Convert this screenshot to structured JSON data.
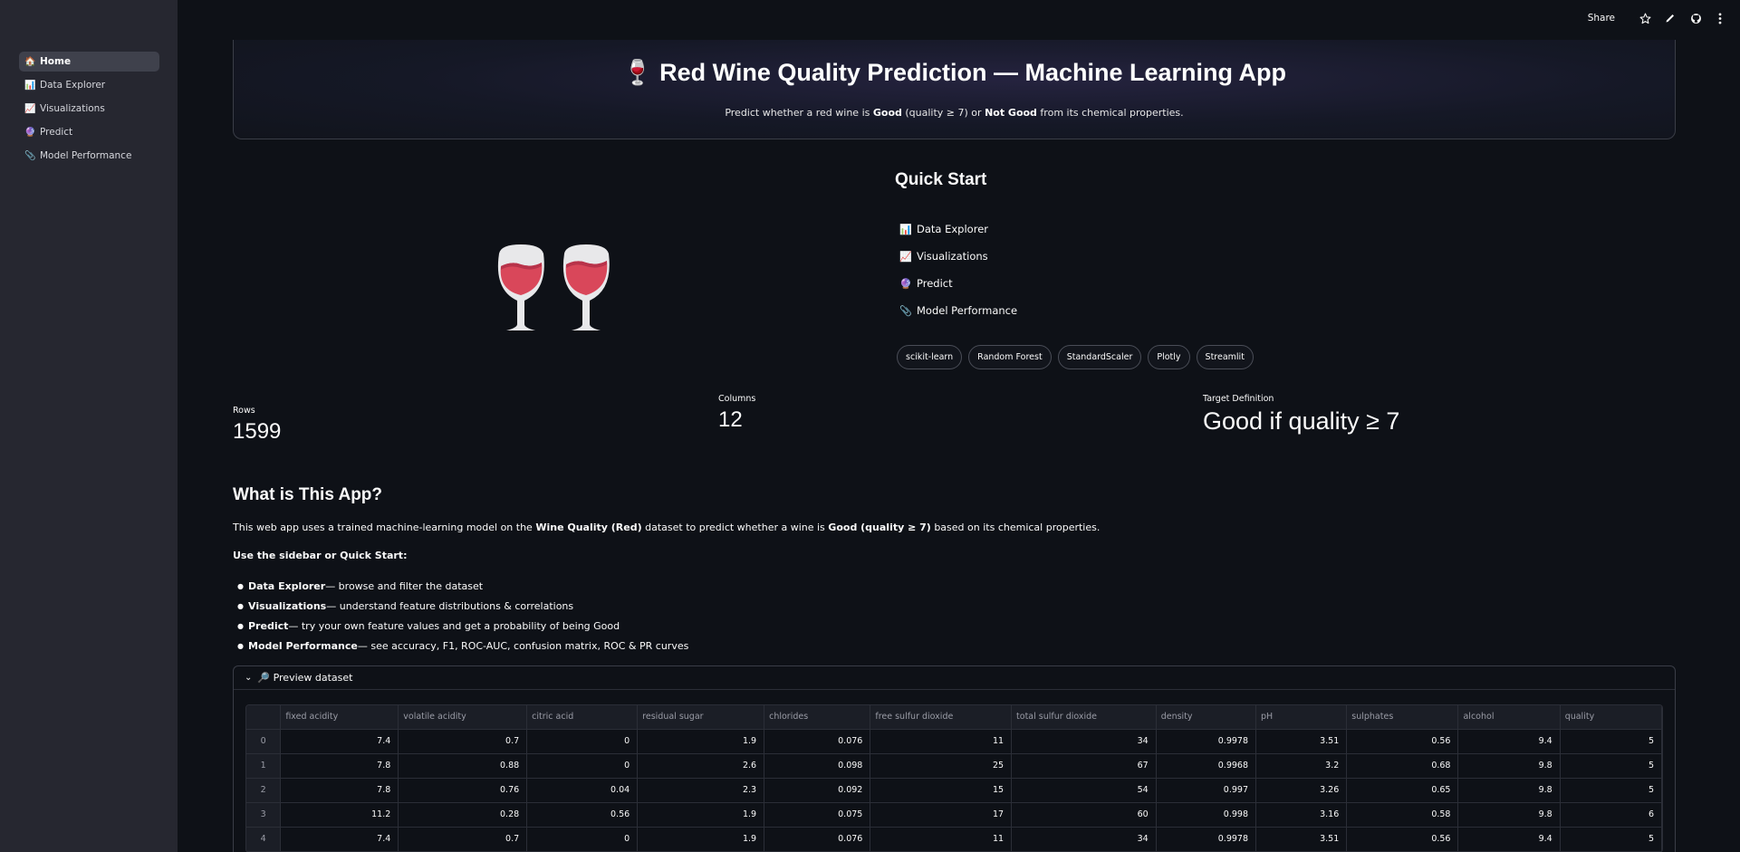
{
  "sidebar": {
    "items": [
      {
        "icon": "🏠",
        "label": "Home"
      },
      {
        "icon": "📊",
        "label": "Data Explorer"
      },
      {
        "icon": "📈",
        "label": "Visualizations"
      },
      {
        "icon": "🔮",
        "label": "Predict"
      },
      {
        "icon": "📎",
        "label": "Model Performance"
      }
    ]
  },
  "topbar": {
    "share_label": "Share",
    "icons": [
      "star-icon",
      "edit-icon",
      "github-icon",
      "more-icon"
    ]
  },
  "hero": {
    "title": "🍷 Red Wine Quality Prediction — Machine Learning App",
    "sub_pre": "Predict whether a red wine is ",
    "sub_good": "Good",
    "sub_mid": " (quality ≥ 7) or ",
    "sub_notgood": "Not Good",
    "sub_post": " from its chemical properties."
  },
  "quick_start": {
    "title": "Quick Start",
    "items": [
      {
        "icon": "📊",
        "label": "Data Explorer"
      },
      {
        "icon": "📈",
        "label": "Visualizations"
      },
      {
        "icon": "🔮",
        "label": "Predict"
      },
      {
        "icon": "📎",
        "label": "Model Performance"
      }
    ],
    "tags": [
      "scikit-learn",
      "Random Forest",
      "StandardScaler",
      "Plotly",
      "Streamlit"
    ]
  },
  "metrics": {
    "rows": {
      "label": "Rows",
      "value": "1599"
    },
    "columns": {
      "label": "Columns",
      "value": "12"
    },
    "target": {
      "label": "Target Definition",
      "value": "Good if quality ≥ 7"
    }
  },
  "about": {
    "heading": "What is This App?",
    "p1_pre": "This web app uses a trained machine-learning model on the ",
    "p1_b1": "Wine Quality (Red)",
    "p1_mid": " dataset to predict whether a wine is ",
    "p1_b2": "Good (quality ≥ 7)",
    "p1_post": " based on its chemical properties.",
    "p2": "Use the sidebar or Quick Start:",
    "bullets": [
      {
        "bold": "Data Explorer",
        "text": " — browse and filter the dataset"
      },
      {
        "bold": "Visualizations",
        "text": " — understand feature distributions & correlations"
      },
      {
        "bold": "Predict",
        "text": " — try your own feature values and get a probability of being Good"
      },
      {
        "bold": "Model Performance",
        "text": " — see accuracy, F1, ROC-AUC, confusion matrix, ROC & PR curves"
      }
    ]
  },
  "preview": {
    "label": "🔎 Preview dataset",
    "columns": [
      "",
      "fixed acidity",
      "volatile acidity",
      "citric acid",
      "residual sugar",
      "chlorides",
      "free sulfur dioxide",
      "total sulfur dioxide",
      "density",
      "pH",
      "sulphates",
      "alcohol",
      "quality"
    ],
    "rows": [
      [
        "0",
        "7.4",
        "0.7",
        "0",
        "1.9",
        "0.076",
        "11",
        "34",
        "0.9978",
        "3.51",
        "0.56",
        "9.4",
        "5"
      ],
      [
        "1",
        "7.8",
        "0.88",
        "0",
        "2.6",
        "0.098",
        "25",
        "67",
        "0.9968",
        "3.2",
        "0.68",
        "9.8",
        "5"
      ],
      [
        "2",
        "7.8",
        "0.76",
        "0.04",
        "2.3",
        "0.092",
        "15",
        "54",
        "0.997",
        "3.26",
        "0.65",
        "9.8",
        "5"
      ],
      [
        "3",
        "11.2",
        "0.28",
        "0.56",
        "1.9",
        "0.075",
        "17",
        "60",
        "0.998",
        "3.16",
        "0.58",
        "9.8",
        "6"
      ],
      [
        "4",
        "7.4",
        "0.7",
        "0",
        "1.9",
        "0.076",
        "11",
        "34",
        "0.9978",
        "3.51",
        "0.56",
        "9.4",
        "5"
      ]
    ]
  }
}
